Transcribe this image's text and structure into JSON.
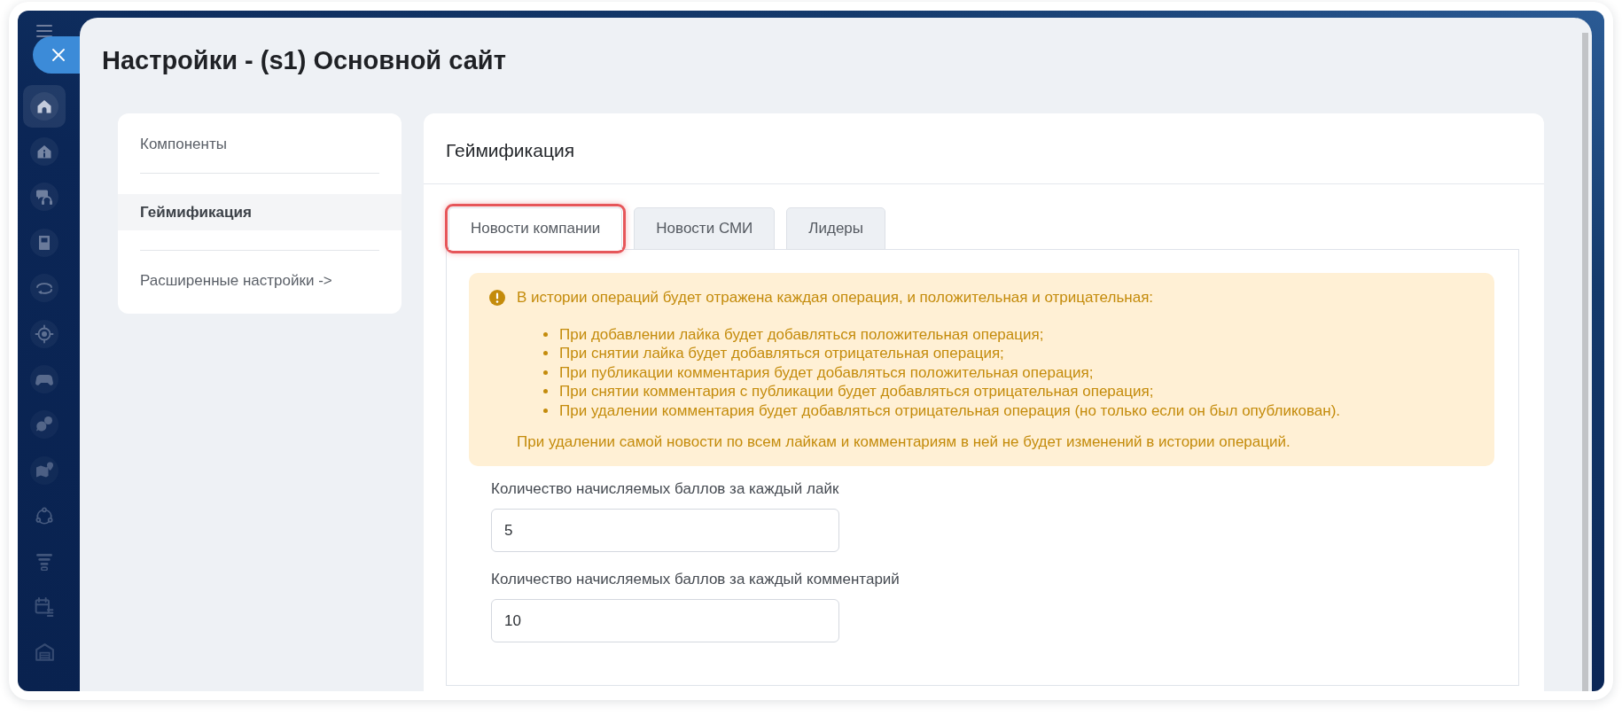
{
  "window": {
    "title": "Настройки - (s1) Основной сайт"
  },
  "rail": {
    "items": [
      {
        "selected": true
      },
      {
        "selected": false
      },
      {
        "selected": false
      },
      {
        "selected": false
      },
      {
        "selected": false
      },
      {
        "selected": false
      },
      {
        "selected": false
      },
      {
        "selected": false
      },
      {
        "selected": false
      },
      {
        "selected": false
      },
      {
        "selected": false
      },
      {
        "selected": false
      },
      {
        "selected": false
      }
    ]
  },
  "nav": {
    "items": [
      {
        "label": "Компоненты",
        "selected": false
      },
      {
        "label": "Геймификация",
        "selected": true
      },
      {
        "label": "Расширенные настройки ->",
        "selected": false
      }
    ]
  },
  "section": {
    "title": "Геймификация",
    "tabs": [
      {
        "label": "Новости компании",
        "selected": true,
        "highlighted": true
      },
      {
        "label": "Новости СМИ",
        "selected": false,
        "highlighted": false
      },
      {
        "label": "Лидеры",
        "selected": false,
        "highlighted": false
      }
    ],
    "alert": {
      "intro": "В истории операций будет отражена каждая операция, и положительная и отрицательная:",
      "bullets": [
        "При добавлении лайка будет добавляться положительная операция;",
        "При снятии лайка будет добавляться отрицательная операция;",
        "При публикации комментария будет добавляться положительная операция;",
        "При снятии комментария с публикации будет добавляться отрицательная операция;",
        "При удалении комментария будет добавляться отрицательная операция (но только если он был опубликован)."
      ],
      "note": "При удалении самой новости по всем лайкам и комментариям в ней не будет изменений в истории операций."
    },
    "fields": [
      {
        "label": "Количество начисляемых баллов за каждый лайк",
        "value": "5"
      },
      {
        "label": "Количество начисляемых баллов за каждый комментарий",
        "value": "10"
      }
    ]
  }
}
